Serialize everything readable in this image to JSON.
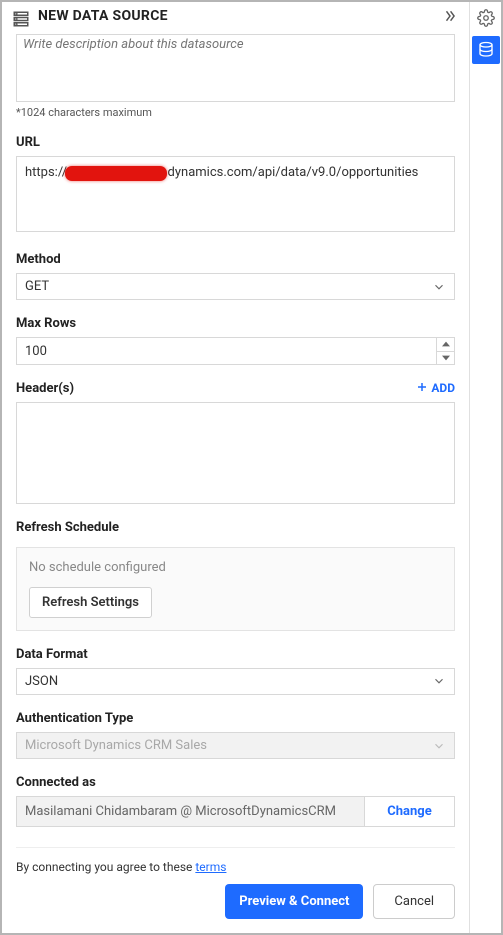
{
  "header": {
    "title": "NEW DATA SOURCE",
    "description_placeholder": "Write description about this datasource"
  },
  "hint": "*1024 characters maximum",
  "url": {
    "label": "URL",
    "value": "https://xxxxxxxxxxx.crm.dynamics.com/api/data/v9.0/opportunities"
  },
  "method": {
    "label": "Method",
    "value": "GET"
  },
  "max_rows": {
    "label": "Max Rows",
    "value": "100"
  },
  "headers": {
    "label": "Header(s)",
    "add_label": "ADD"
  },
  "refresh": {
    "label": "Refresh Schedule",
    "status": "No schedule configured",
    "button": "Refresh Settings"
  },
  "data_format": {
    "label": "Data Format",
    "value": "JSON"
  },
  "auth_type": {
    "label": "Authentication Type",
    "value": "Microsoft Dynamics CRM Sales"
  },
  "connected": {
    "label": "Connected as",
    "value": "Masilamani Chidambaram @ MicrosoftDynamicsCRM",
    "change": "Change"
  },
  "terms": {
    "prefix": "By connecting you agree to these ",
    "link": "terms"
  },
  "actions": {
    "primary": "Preview & Connect",
    "secondary": "Cancel"
  }
}
